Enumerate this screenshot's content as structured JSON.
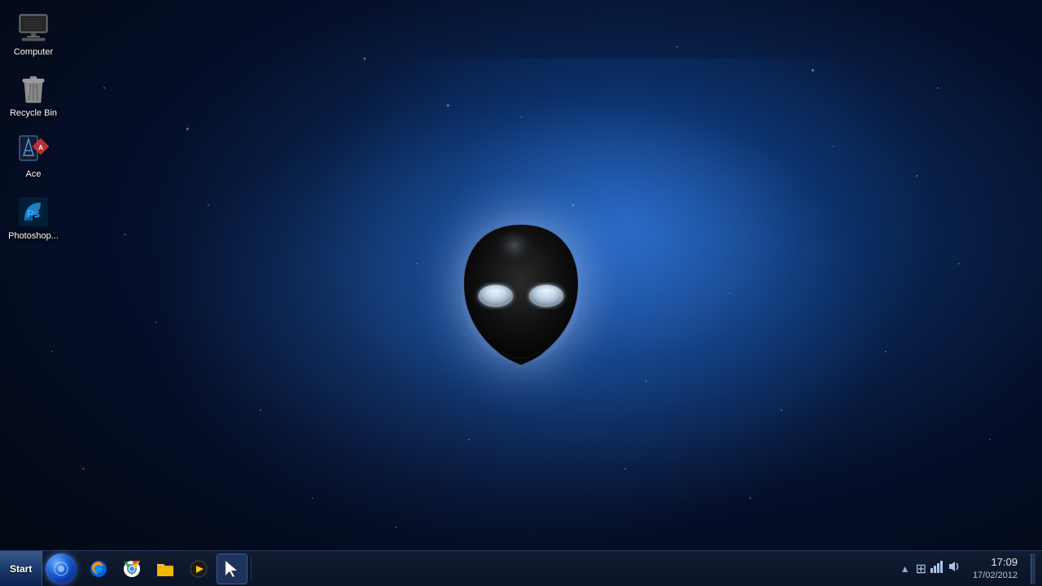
{
  "desktop": {
    "background_description": "Alienware dark space wallpaper with blue nebula and stars",
    "icons": [
      {
        "id": "computer",
        "label": "Computer",
        "icon_type": "computer"
      },
      {
        "id": "recycle-bin",
        "label": "Recycle Bin",
        "icon_type": "recycle-bin"
      },
      {
        "id": "ace",
        "label": "Ace",
        "icon_type": "ace"
      },
      {
        "id": "photoshop",
        "label": "Photoshop...",
        "icon_type": "photoshop"
      }
    ]
  },
  "taskbar": {
    "start_label": "Start",
    "icons": [
      {
        "id": "firefox",
        "label": "Firefox",
        "emoji": "🦊"
      },
      {
        "id": "chrome",
        "label": "Chrome",
        "emoji": "🌐"
      },
      {
        "id": "files",
        "label": "Files",
        "emoji": "📁"
      },
      {
        "id": "media",
        "label": "Media Player",
        "emoji": "▶"
      },
      {
        "id": "active-app",
        "label": "Active App",
        "emoji": "⬛",
        "active": true
      }
    ],
    "system_tray": {
      "time": "17:09",
      "date": "17/02/2012",
      "icons": [
        "network",
        "volume",
        "clock"
      ]
    }
  }
}
